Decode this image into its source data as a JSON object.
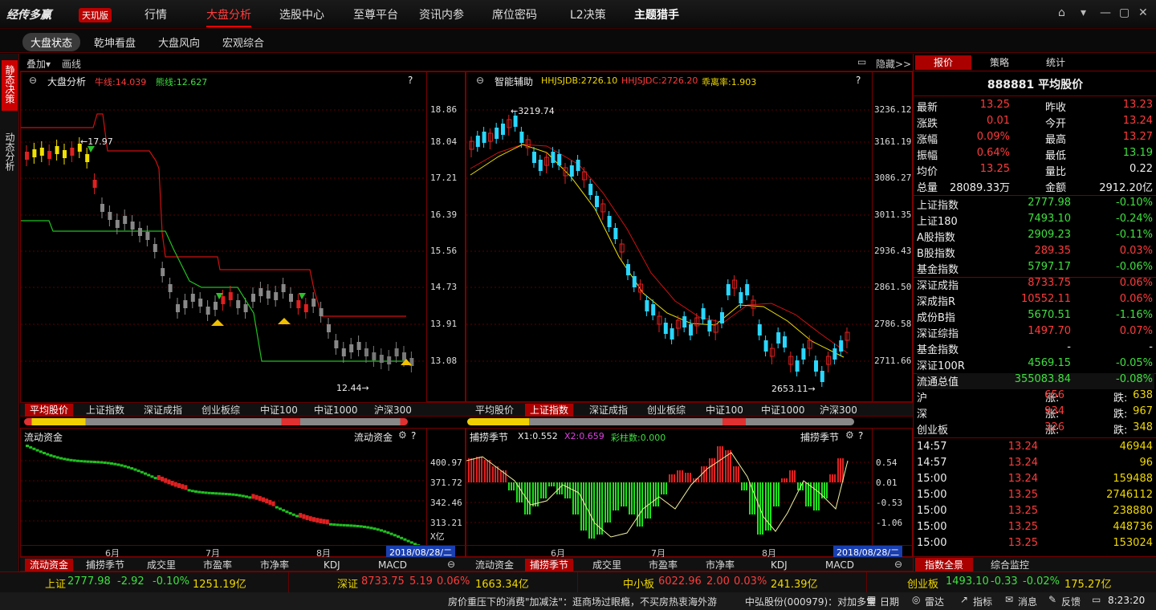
{
  "app": {
    "logo": "经传多赢",
    "badge": "天玑版"
  },
  "nav": [
    "行情",
    "大盘分析",
    "选股中心",
    "至尊平台",
    "资讯内参",
    "席位密码",
    "L2决策",
    "主题猎手"
  ],
  "subnav": [
    "大盘状态",
    "乾坤看盘",
    "大盘风向",
    "宏观综合"
  ],
  "lefttabs": [
    "静态决策",
    "动态分析"
  ],
  "toolbar": {
    "overlay": "叠加▾",
    "draw": "画线",
    "hide": "隐藏>>"
  },
  "panelA": {
    "title": "大盘分析",
    "bull": "牛线:14.039",
    "bear": "熊线:12.627",
    "q": "?",
    "high": "17.97",
    "low": "12.44",
    "ticks": [
      "18.86",
      "18.04",
      "17.21",
      "16.39",
      "15.56",
      "14.73",
      "13.91",
      "13.08"
    ]
  },
  "panelB": {
    "title": "智能辅助",
    "f1": "HHJSJDB:2726.10",
    "f2": "HHJSJDC:2726.20",
    "f3": "乖离率:1.903",
    "q": "?",
    "high": "3219.74",
    "low": "2653.11",
    "ticks": [
      "3236.12",
      "3161.19",
      "3086.27",
      "3011.35",
      "2936.43",
      "2861.50",
      "2786.58",
      "2711.66"
    ]
  },
  "tabsTop": [
    "平均股价",
    "上证指数",
    "深证成指",
    "创业板综",
    "中证100",
    "中证1000",
    "沪深300"
  ],
  "panelC": {
    "title": "流动资金",
    "right": "流动资金",
    "ticks": [
      "400.97",
      "371.72",
      "342.46",
      "313.21",
      "X亿"
    ],
    "months": [
      "6月",
      "7月",
      "8月"
    ],
    "date": "2018/08/28/二"
  },
  "panelD": {
    "title": "捕捞季节",
    "x1": "X1:0.552",
    "x2": "X2:0.659",
    "bars": "彩柱数:0.000",
    "right": "捕捞季节",
    "ticks": [
      "0.54",
      "0.01",
      "-0.53",
      "-1.06"
    ],
    "months": [
      "6月",
      "7月",
      "8月"
    ],
    "date": "2018/08/28/二"
  },
  "tabsBottom": [
    "流动资金",
    "捕捞季节",
    "成交里",
    "市盈率",
    "市净率",
    "KDJ",
    "MACD"
  ],
  "right": {
    "tabs": [
      "报价",
      "策略",
      "统计"
    ],
    "title": "888881 平均股价",
    "quote": [
      [
        "最新",
        "13.25",
        "昨收",
        "13.23"
      ],
      [
        "涨跌",
        "0.01",
        "今开",
        "13.24"
      ],
      [
        "涨幅",
        "0.09%",
        "最高",
        "13.27"
      ],
      [
        "振幅",
        "0.64%",
        "最低",
        "13.19"
      ],
      [
        "均价",
        "13.25",
        "量比",
        "0.22"
      ],
      [
        "总量",
        "28089.33万",
        "金额",
        "2912.20亿"
      ]
    ],
    "indices": [
      [
        "上证指数",
        "2777.98",
        "-0.10%"
      ],
      [
        "上证180",
        "7493.10",
        "-0.24%"
      ],
      [
        "A股指数",
        "2909.23",
        "-0.11%"
      ],
      [
        "B股指数",
        "289.35",
        "0.03%"
      ],
      [
        "基金指数",
        "5797.17",
        "-0.06%"
      ],
      [
        "深证成指",
        "8733.75",
        "0.06%"
      ],
      [
        "深成指R",
        "10552.11",
        "0.06%"
      ],
      [
        "成份B指",
        "5670.51",
        "-1.16%"
      ],
      [
        "深证综指",
        "1497.70",
        "0.07%"
      ],
      [
        "基金指数",
        "-",
        "-"
      ],
      [
        "深证100R",
        "4569.15",
        "-0.05%"
      ],
      [
        "流通总值",
        "355083.84",
        "-0.08%"
      ]
    ],
    "breadth": [
      [
        "沪",
        "涨:",
        "656",
        "跌:",
        "638"
      ],
      [
        "深",
        "涨:",
        "934",
        "跌:",
        "967"
      ],
      [
        "创业板",
        "涨:",
        "326",
        "跌:",
        "348"
      ]
    ],
    "ticks": [
      [
        "14:57",
        "13.24",
        "46944"
      ],
      [
        "14:57",
        "13.24",
        "96"
      ],
      [
        "15:00",
        "13.24",
        "159488"
      ],
      [
        "15:00",
        "13.25",
        "2746112"
      ],
      [
        "15:00",
        "13.25",
        "238880"
      ],
      [
        "15:00",
        "13.25",
        "448736"
      ],
      [
        "15:00",
        "13.25",
        "153024"
      ]
    ],
    "bottomTabs": [
      "指数全景",
      "综合监控"
    ]
  },
  "ticker": [
    {
      "name": "上证",
      "v": "2777.98",
      "c": "-2.92",
      "p": "-0.10%",
      "amt": "1251.19亿"
    },
    {
      "name": "深证",
      "v": "8733.75",
      "c": "5.19",
      "p": "0.06%",
      "amt": "1663.34亿"
    },
    {
      "name": "中小板",
      "v": "6022.96",
      "c": "2.00",
      "p": "0.03%",
      "amt": "241.39亿"
    },
    {
      "name": "创业板",
      "v": "1493.10",
      "c": "-0.33",
      "p": "-0.02%",
      "amt": "175.27亿"
    }
  ],
  "status": {
    "news1": "房价重压下的消费\"加减法\"：逛商场过眼瘾，不买房热衷海外游",
    "news2": "中弘股份(000979)：对加多宝",
    "b1": "日期",
    "b2": "雷达",
    "b3": "指标",
    "b4": "消息",
    "b5": "反馈",
    "time": "8:23:20"
  }
}
